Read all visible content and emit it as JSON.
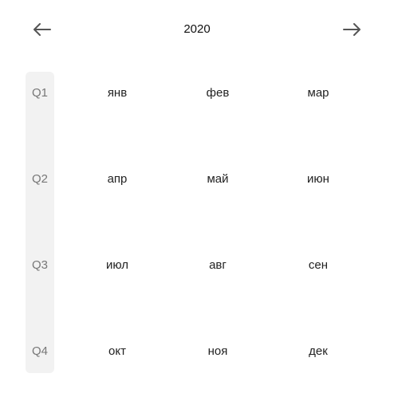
{
  "header": {
    "year": "2020",
    "prev_icon": "arrow-left-icon",
    "next_icon": "arrow-right-icon"
  },
  "quarters": [
    {
      "label": "Q1",
      "months": [
        "янв",
        "фев",
        "мар"
      ]
    },
    {
      "label": "Q2",
      "months": [
        "апр",
        "май",
        "июн"
      ]
    },
    {
      "label": "Q3",
      "months": [
        "июл",
        "авг",
        "сен"
      ]
    },
    {
      "label": "Q4",
      "months": [
        "окт",
        "ноя",
        "дек"
      ]
    }
  ]
}
